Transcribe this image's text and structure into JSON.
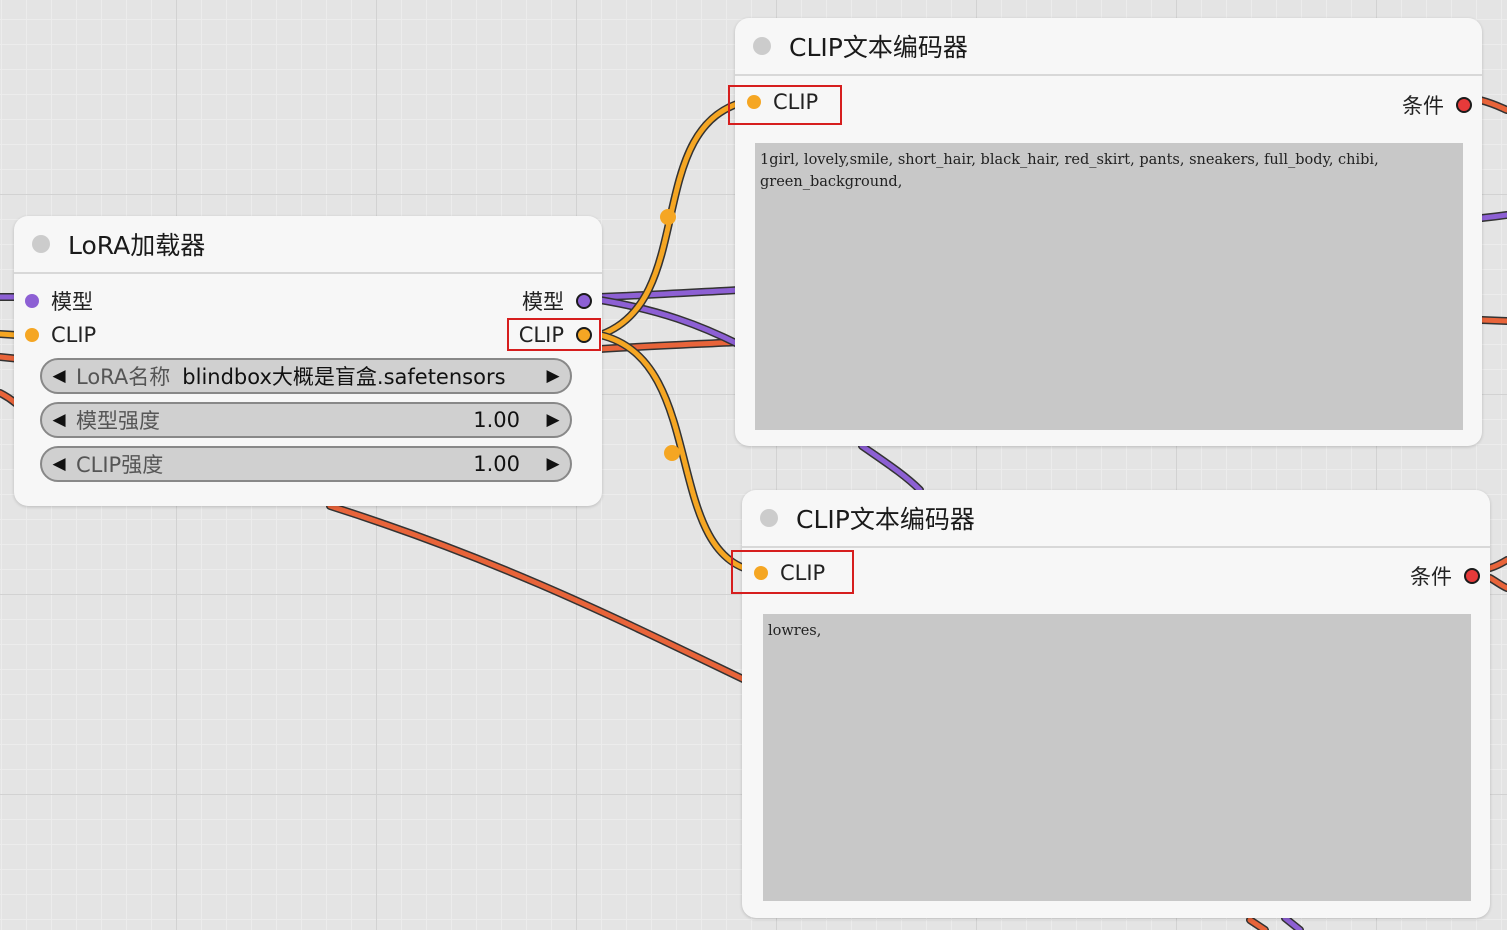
{
  "colors": {
    "canvas_bg": "#e4e4e4",
    "node_bg": "#f7f7f7",
    "clip_link": "#f5a623",
    "model_link": "#8d60d4",
    "conditioning_link": "#e8643a",
    "highlight_box": "#d61e1e"
  },
  "lora_node": {
    "title": "LoRA加载器",
    "inputs": [
      {
        "label": "模型",
        "type": "MODEL"
      },
      {
        "label": "CLIP",
        "type": "CLIP"
      }
    ],
    "outputs": [
      {
        "label": "模型",
        "type": "MODEL"
      },
      {
        "label": "CLIP",
        "type": "CLIP"
      }
    ],
    "widgets": [
      {
        "label": "LoRA名称",
        "value": "blindbox大概是盲盒.safetensors"
      },
      {
        "label": "模型强度",
        "value": "1.00"
      },
      {
        "label": "CLIP强度",
        "value": "1.00"
      }
    ]
  },
  "clip_encoders": [
    {
      "title": "CLIP文本编码器",
      "input_label": "CLIP",
      "output_label": "条件",
      "text": "1girl, lovely,smile, short_hair, black_hair, red_skirt, pants, sneakers, full_body, chibi, green_background,"
    },
    {
      "title": "CLIP文本编码器",
      "input_label": "CLIP",
      "output_label": "条件",
      "text": "lowres,"
    }
  ]
}
